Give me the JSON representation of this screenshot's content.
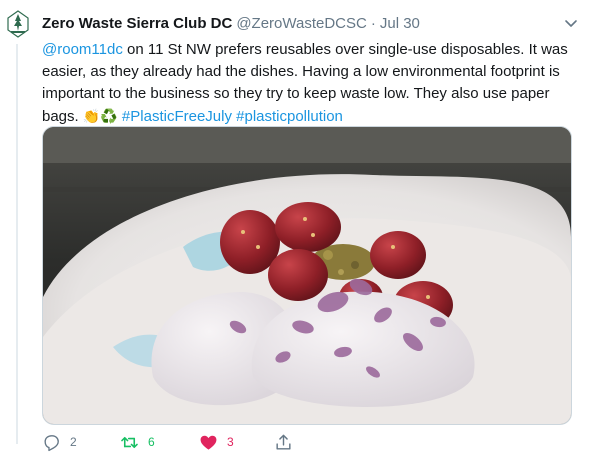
{
  "tweet": {
    "author": {
      "display_name": "Zero Waste Sierra Club DC",
      "handle": "@ZeroWasteDCSC",
      "separator": "·",
      "time": "Jul 30"
    },
    "text": {
      "mention": "@room11dc",
      "body": " on 11 St NW prefers reusables over single-use disposables. It was easier, as they already had the dishes. Having a low environmental footprint is important to the business so they try to keep waste low. They also use paper bags. ",
      "emoji": "👏♻️",
      "hashtag1": "#PlasticFreeJuly",
      "space": " ",
      "hashtag2": "#plasticpollution"
    },
    "media": {
      "subject": "strawberries with crumble, whipped cream and dried rose petals in a white bowl"
    },
    "actions": {
      "reply_count": "2",
      "retweet_count": "6",
      "like_count": "3"
    }
  },
  "colors": {
    "link": "#1b95e0",
    "retweet": "#17bf63",
    "like": "#e0245e",
    "secondary": "#657786"
  },
  "icons": [
    "sierra-club-logo-icon",
    "chevron-down-icon",
    "reply-icon",
    "retweet-icon",
    "heart-icon",
    "share-icon"
  ]
}
